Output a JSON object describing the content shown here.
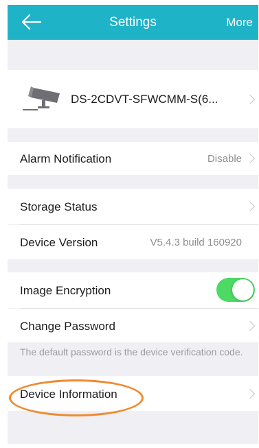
{
  "nav": {
    "title": "Settings",
    "more_label": "More"
  },
  "device": {
    "name": "DS-2CDVT-SFWCMM-S(6..."
  },
  "rows": {
    "alarm_notification": {
      "label": "Alarm Notification",
      "value": "Disable"
    },
    "storage_status": {
      "label": "Storage Status"
    },
    "device_version": {
      "label": "Device Version",
      "value": "V5.4.3 build 160920"
    },
    "image_encryption": {
      "label": "Image Encryption",
      "enabled": true
    },
    "change_password": {
      "label": "Change Password"
    },
    "password_hint": "The default password is the device verification code.",
    "device_information": {
      "label": "Device Information"
    }
  },
  "icons": {
    "back": "back-arrow-icon",
    "camera": "security-camera-icon",
    "chevron": "chevron-right-icon"
  },
  "colors": {
    "nav_bar": "#1fb3c7",
    "toggle_on": "#4cd964",
    "highlight": "#f08a30",
    "background": "#efeff4"
  }
}
